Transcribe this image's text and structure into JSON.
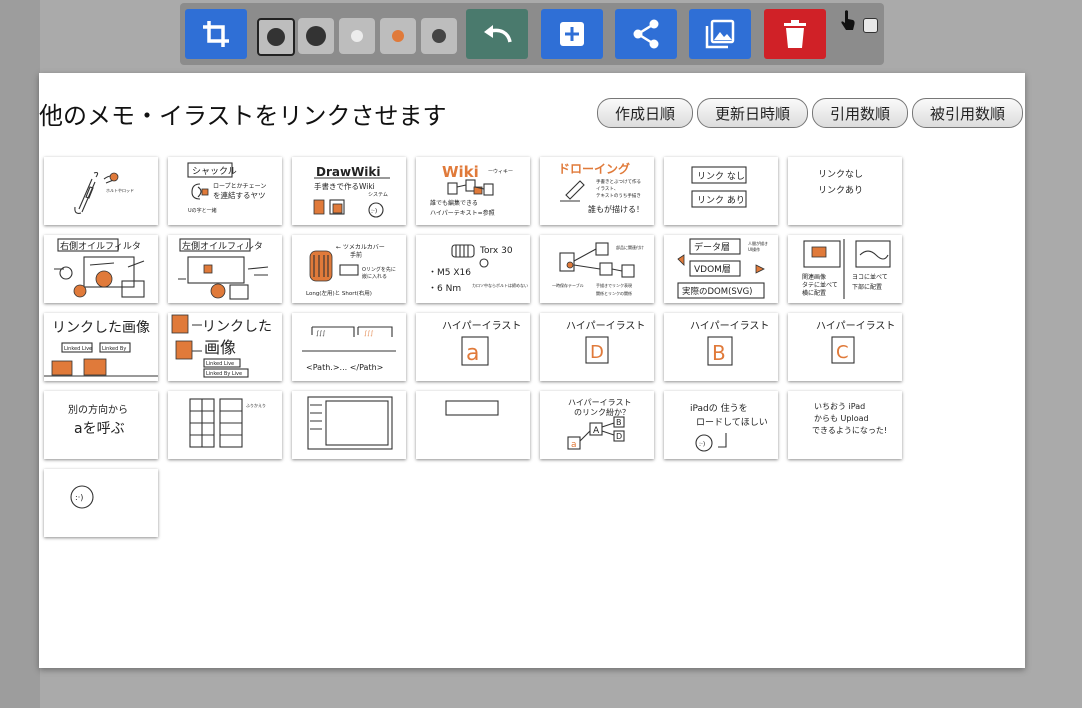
{
  "toolbar": {
    "buttons": [
      {
        "name": "crop-icon"
      },
      {
        "name": "pen-size-large",
        "color": "#333333"
      },
      {
        "name": "pen-size-medium",
        "color": "#333333"
      },
      {
        "name": "pen-color-gray",
        "color": "#d0d0d0"
      },
      {
        "name": "pen-color-orange",
        "color": "#e07a3a"
      },
      {
        "name": "pen-color-dark",
        "color": "#444444"
      },
      {
        "name": "undo-icon"
      },
      {
        "name": "add-icon"
      },
      {
        "name": "share-icon"
      },
      {
        "name": "gallery-icon"
      },
      {
        "name": "trash-icon"
      },
      {
        "name": "hand-pointer-icon"
      }
    ],
    "checkbox_checked": false
  },
  "page": {
    "title": "他のメモ・イラストをリンクさせます",
    "sort_buttons": [
      "作成日順",
      "更新日時順",
      "引用数順",
      "被引用数順"
    ]
  },
  "cards": [
    {
      "lines": []
    },
    {
      "lines": [
        "シャックル",
        "ロープとかチェーン",
        "を連結するヤツ",
        "Uの字と一緒"
      ]
    },
    {
      "lines": [
        "DrawWiki",
        "手書きで作るWiki",
        "システム"
      ]
    },
    {
      "lines": [
        "Wiki",
        "誰でも編集できる",
        "ハイパーテキスト=参照"
      ]
    },
    {
      "lines": [
        "ドローイング",
        "誰もが描ける！"
      ]
    },
    {
      "lines": [
        "リンク なし",
        "リンク あり"
      ]
    },
    {
      "lines": [
        "リンクなし",
        "リンクあり"
      ]
    },
    {
      "lines": [
        "右側オイルフィルタ"
      ]
    },
    {
      "lines": [
        "左側オイルフィルタ"
      ]
    },
    {
      "lines": [
        "← ツメカルカバー",
        "手前",
        "Long(左用)と Short(右用)"
      ]
    },
    {
      "lines": [
        "Torx 30",
        "・M5 X16",
        "・6 Nm"
      ]
    },
    {
      "lines": []
    },
    {
      "lines": [
        "データ層",
        "VDOM層",
        "実際のDOM(SVG)"
      ]
    },
    {
      "lines": [
        "関連画像",
        "ヨコに並べて"
      ]
    },
    {
      "lines": [
        "リンクした画像",
        "Linked Live",
        "Linked By"
      ]
    },
    {
      "lines": [
        "リンクした",
        "画像",
        "Linked Live",
        "Linked By Live"
      ]
    },
    {
      "lines": [
        "<Path.>... </Path>"
      ]
    },
    {
      "lines": [
        "ハイパーイラスト",
        "a"
      ]
    },
    {
      "lines": [
        "ハイパーイラスト",
        "D"
      ]
    },
    {
      "lines": [
        "ハイパーイラスト",
        "B"
      ]
    },
    {
      "lines": [
        "ハイパーイラスト",
        "C"
      ]
    },
    {
      "lines": [
        "別の方向から",
        "aを呼ぶ"
      ]
    },
    {
      "lines": []
    },
    {
      "lines": []
    },
    {
      "lines": []
    },
    {
      "lines": [
        "ハイパーイラスト",
        "のリンク紛か？",
        "a",
        "A",
        "B",
        "D"
      ]
    },
    {
      "lines": [
        "iPadの 住うを",
        "ロードしてほしい"
      ]
    },
    {
      "lines": [
        "いちおう iPad",
        "からも Upload",
        "できるようになった!"
      ]
    },
    {
      "lines": []
    }
  ]
}
